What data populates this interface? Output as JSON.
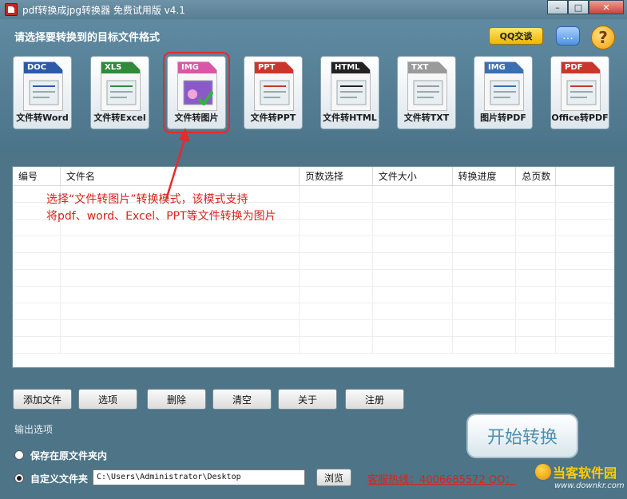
{
  "window": {
    "title": "pdf转换成jpg转换器 免费试用版 v4.1",
    "minimize_label": "–",
    "maximize_label": "□",
    "close_label": "✕"
  },
  "header": {
    "heading": "请选择要转换到的目标文件格式",
    "qq_label": "QQ交谈",
    "help_label": "?",
    "chat_label": "…"
  },
  "modes": [
    {
      "tag": "DOC",
      "label": "文件转Word",
      "tag_color": "#2d5aa8",
      "selected": false,
      "icon": "word-doc-icon"
    },
    {
      "tag": "XLS",
      "label": "文件转Excel",
      "tag_color": "#2f8a3a",
      "selected": false,
      "icon": "excel-chart-icon"
    },
    {
      "tag": "IMG",
      "label": "文件转图片",
      "tag_color": "#d957a6",
      "selected": true,
      "icon": "image-photo-icon"
    },
    {
      "tag": "PPT",
      "label": "文件转PPT",
      "tag_color": "#c9372c",
      "selected": false,
      "icon": "ppt-slide-icon"
    },
    {
      "tag": "HTML",
      "label": "文件转HTML",
      "tag_color": "#222222",
      "selected": false,
      "icon": "html-globe-icon"
    },
    {
      "tag": "TXT",
      "label": "文件转TXT",
      "tag_color": "#9a9a9a",
      "selected": false,
      "icon": "txt-pencil-icon"
    },
    {
      "tag": "IMG",
      "label": "图片转PDF",
      "tag_color": "#3a6fb0",
      "selected": false,
      "icon": "image-to-pdf-icon"
    },
    {
      "tag": "PDF",
      "label": "Office转PDF",
      "tag_color": "#c9372c",
      "selected": false,
      "icon": "office-to-pdf-icon"
    }
  ],
  "table": {
    "columns": [
      "编号",
      "文件名",
      "页数选择",
      "文件大小",
      "转换进度",
      "总页数"
    ],
    "rows": []
  },
  "annotation": {
    "line1": "选择“文件转图片”转换模式，该模式支持",
    "line2": "将pdf、word、Excel、PPT等文件转换为图片"
  },
  "toolbar": {
    "add_file": "添加文件",
    "options": "选项",
    "delete": "删除",
    "clear": "清空",
    "about": "关于",
    "register": "注册"
  },
  "output": {
    "section_title": "输出选项",
    "save_original": "保存在原文件夹内",
    "custom_folder": "自定义文件夹",
    "selected": "custom",
    "path": "C:\\Users\\Administrator\\Desktop",
    "browse": "浏览"
  },
  "start_button": "开始转换",
  "hotline": "客服热线：4006685572 QQ：",
  "watermark": {
    "title": "当客软件园",
    "url": "www.downkr.com"
  },
  "colors": {
    "accent_red": "#d8241d",
    "window_bg": "#4d7487"
  }
}
